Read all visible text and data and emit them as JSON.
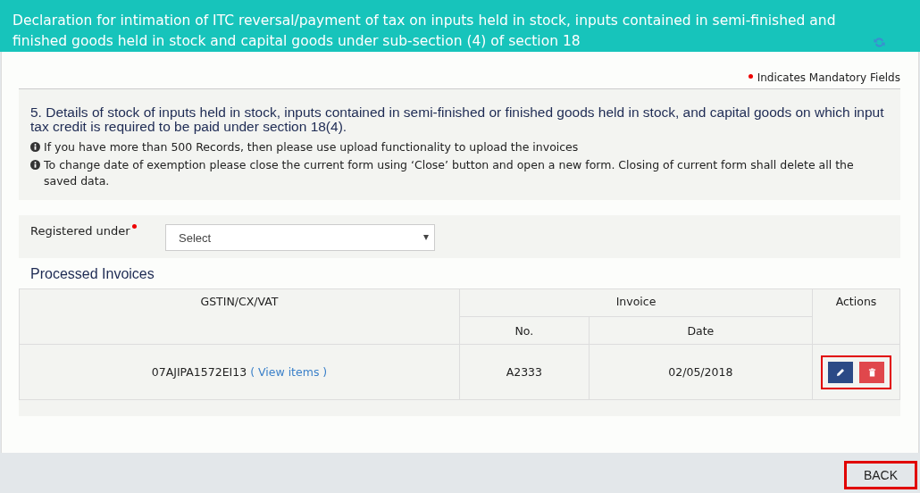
{
  "header": {
    "title": "Declaration for intimation of ITC reversal/payment of tax on inputs held in stock, inputs contained in semi-finished and finished goods held in stock and capital goods under sub-section (4) of section 18"
  },
  "mandatory_note": "Indicates Mandatory Fields",
  "info_panel": {
    "heading": "5. Details of stock of inputs held in stock, inputs contained in semi-finished or finished goods held in stock, and capital goods on which input tax credit is required to be paid under section 18(4).",
    "notes": [
      "If you have more than 500 Records, then please use upload functionality to upload the invoices",
      "To change date of exemption please close the current form using ‘Close’ button and open a new form. Closing of current form shall delete all the saved data."
    ]
  },
  "registered_under": {
    "label": "Registered under",
    "required": true,
    "value": "Select"
  },
  "processed_invoices": {
    "title": "Processed Invoices",
    "columns": {
      "gstin": "GSTIN/CX/VAT",
      "invoice": "Invoice",
      "no": "No.",
      "date": "Date",
      "actions": "Actions"
    },
    "rows": [
      {
        "gstin": "07AJIPA1572EI13",
        "link": "( View items )",
        "no": "A2333",
        "date": "02/05/2018",
        "highlighted": true
      }
    ]
  },
  "back_button": {
    "label": "BACK",
    "highlighted": true
  }
}
